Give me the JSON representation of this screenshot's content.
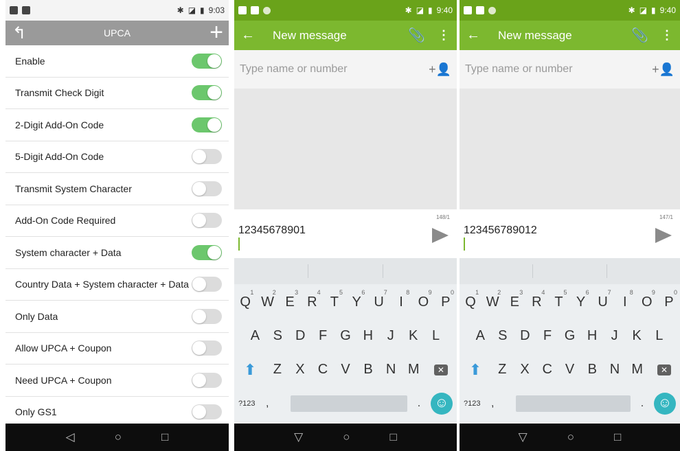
{
  "phone1": {
    "status": {
      "time": "9:03",
      "bt": "✱",
      "signal": "◪",
      "battery": "▮"
    },
    "header": {
      "back_icon": "↰",
      "title": "UPCA",
      "add_icon": "+"
    },
    "settings": [
      {
        "label": "Enable",
        "on": true
      },
      {
        "label": "Transmit Check Digit",
        "on": true
      },
      {
        "label": "2-Digit Add-On Code",
        "on": true
      },
      {
        "label": "5-Digit Add-On Code",
        "on": false
      },
      {
        "label": "Transmit System Character",
        "on": false
      },
      {
        "label": "Add-On Code Required",
        "on": false
      },
      {
        "label": "System character + Data",
        "on": true
      },
      {
        "label": "Country Data + System character + Data",
        "on": false
      },
      {
        "label": "Only Data",
        "on": false
      },
      {
        "label": "Allow UPCA + Coupon",
        "on": false
      },
      {
        "label": "Need UPCA + Coupon",
        "on": false
      },
      {
        "label": "Only GS1",
        "on": false
      }
    ],
    "nav": {
      "back": "◁",
      "home": "○",
      "recent": "□"
    }
  },
  "phone2": {
    "status": {
      "time": "9:40",
      "bt": "✱",
      "signal": "◪",
      "battery": "▮"
    },
    "appbar": {
      "back_icon": "←",
      "title": "New message",
      "attach_icon": "📎",
      "more_icon": "⋮"
    },
    "recipient": {
      "placeholder": "Type name or number",
      "add_icon": "+👤"
    },
    "compose": {
      "text": "12345678901",
      "counter": "148/1"
    },
    "nav": {
      "back": "▽",
      "home": "○",
      "recent": "□"
    }
  },
  "phone3": {
    "status": {
      "time": "9:40",
      "bt": "✱",
      "signal": "◪",
      "battery": "▮"
    },
    "appbar": {
      "back_icon": "←",
      "title": "New message",
      "attach_icon": "📎",
      "more_icon": "⋮"
    },
    "recipient": {
      "placeholder": "Type name or number",
      "add_icon": "+👤"
    },
    "compose": {
      "text": "123456789012",
      "counter": "147/1"
    },
    "nav": {
      "back": "▽",
      "home": "○",
      "recent": "□"
    }
  },
  "keyboard": {
    "row1": [
      [
        "Q",
        "1"
      ],
      [
        "W",
        "2"
      ],
      [
        "E",
        "3"
      ],
      [
        "R",
        "4"
      ],
      [
        "T",
        "5"
      ],
      [
        "Y",
        "6"
      ],
      [
        "U",
        "7"
      ],
      [
        "I",
        "8"
      ],
      [
        "O",
        "9"
      ],
      [
        "P",
        "0"
      ]
    ],
    "row2": [
      "A",
      "S",
      "D",
      "F",
      "G",
      "H",
      "J",
      "K",
      "L"
    ],
    "row3": [
      "Z",
      "X",
      "C",
      "V",
      "B",
      "N",
      "M"
    ],
    "shift_icon": "⬆",
    "delete_icon": "✕",
    "symbols_key": "?123",
    "comma_key": ",",
    "period_key": ".",
    "emoji_icon": "☺"
  },
  "colors": {
    "toggle_on": "#6cc76d",
    "toggle_off": "#dcdcdc",
    "appbar": "#7cb82f",
    "status_green": "#6aa31a",
    "header_gray": "#9a9a9a"
  }
}
